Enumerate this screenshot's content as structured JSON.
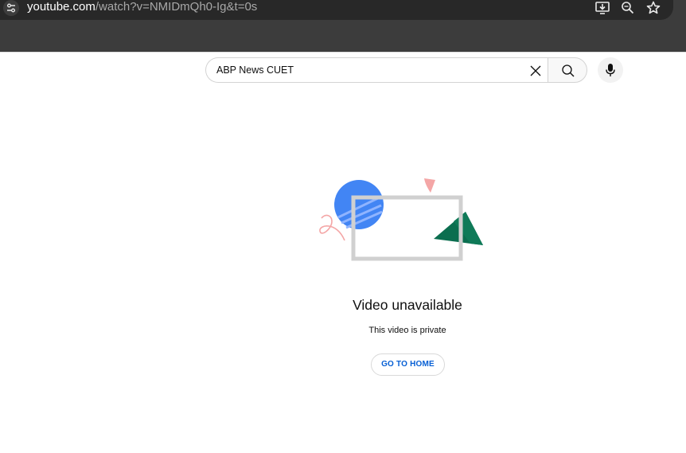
{
  "browser": {
    "url_domain": "youtube.com",
    "url_path": "/watch?v=NMIDmQh0-Ig&t=0s",
    "icons": [
      "site-info-icon",
      "install-app-icon",
      "zoom-icon",
      "bookmark-star-icon"
    ]
  },
  "search": {
    "query": "ABP News CUET",
    "icons": [
      "clear-icon",
      "search-icon",
      "microphone-icon"
    ]
  },
  "error": {
    "title": "Video unavailable",
    "subtitle": "This video is private",
    "button_label": "GO TO HOME"
  },
  "colors": {
    "link_blue": "#065fd4",
    "illustration_blue": "#4285f4",
    "illustration_green": "#0b6e4f",
    "illustration_pink": "#f4a6a6"
  }
}
